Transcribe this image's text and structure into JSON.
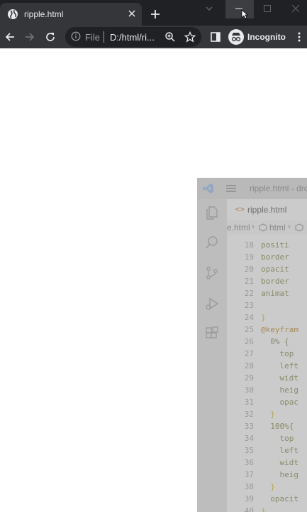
{
  "browser": {
    "tab_title": "ripple.html",
    "omnibox": {
      "scheme_label": "File",
      "url": "D:/html/ri..."
    },
    "profile_label": "Incognito",
    "icons": [
      "globe-favicon-icon",
      "close-icon",
      "plus-icon",
      "chevron-down-icon",
      "minimize-icon",
      "maximize-icon",
      "window-close-icon",
      "back-icon",
      "forward-icon",
      "reload-icon",
      "info-icon",
      "zoom-icon",
      "star-icon",
      "side-panel-icon",
      "incognito-icon",
      "kebab-menu-icon"
    ]
  },
  "vscode": {
    "window_title": "ripple.html - drop",
    "tab_label": "ripple.html",
    "breadcrumb": [
      "e.html",
      "html"
    ],
    "code_lines": [
      {
        "n": "18",
        "text": "positi",
        "cls": ""
      },
      {
        "n": "19",
        "text": "border",
        "cls": ""
      },
      {
        "n": "20",
        "text": "opacit",
        "cls": ""
      },
      {
        "n": "21",
        "text": "border",
        "cls": ""
      },
      {
        "n": "22",
        "text": "animat",
        "cls": ""
      },
      {
        "n": "23",
        "text": "",
        "cls": ""
      },
      {
        "n": "24",
        "text": "}",
        "cls": "brace"
      },
      {
        "n": "25",
        "text": "@keyfram",
        "cls": "kw"
      },
      {
        "n": "26",
        "text": "  0% {",
        "cls": ""
      },
      {
        "n": "27",
        "text": "    top",
        "cls": ""
      },
      {
        "n": "28",
        "text": "    left",
        "cls": ""
      },
      {
        "n": "29",
        "text": "    widt",
        "cls": ""
      },
      {
        "n": "30",
        "text": "    heig",
        "cls": ""
      },
      {
        "n": "31",
        "text": "    opac",
        "cls": ""
      },
      {
        "n": "32",
        "text": "  }",
        "cls": "brace"
      },
      {
        "n": "33",
        "text": "  100%{",
        "cls": ""
      },
      {
        "n": "34",
        "text": "    top",
        "cls": ""
      },
      {
        "n": "35",
        "text": "    left",
        "cls": ""
      },
      {
        "n": "36",
        "text": "    widt",
        "cls": ""
      },
      {
        "n": "37",
        "text": "    heig",
        "cls": ""
      },
      {
        "n": "38",
        "text": "  }",
        "cls": "brace"
      },
      {
        "n": "39",
        "text": "  opacit",
        "cls": ""
      },
      {
        "n": "40",
        "text": "}",
        "cls": "brace"
      }
    ]
  },
  "colors": {
    "chrome_dark": "#202124",
    "chrome_toolbar": "#35363a",
    "text_light": "#e8eaed",
    "vscode_faded": "#c8c8c8"
  }
}
